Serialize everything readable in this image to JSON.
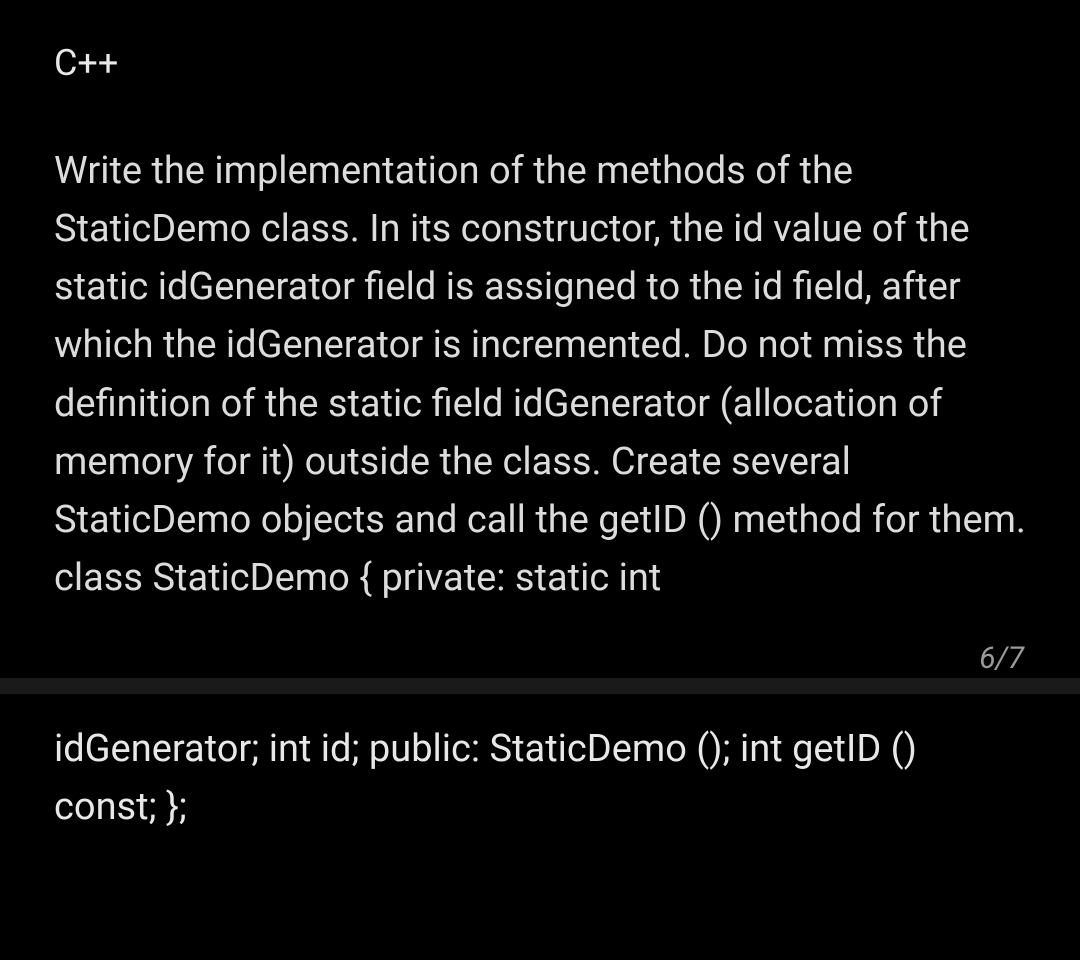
{
  "title": "C++",
  "bodyText": "Write the implementation of the methods of the StaticDemo class. In its constructor, the id value of the static idGenerator field is assigned to the id field, after which the idGenerator is incremented. Do not miss the definition of the static field idGenerator (allocation of memory for it) outside the class. Create several StaticDemo objects and call the getID () method for them. class StaticDemo { private: static int",
  "pageIndicator": "6/7",
  "bottomText": "idGenerator; int id; public: StaticDemo (); int getID () const; };"
}
